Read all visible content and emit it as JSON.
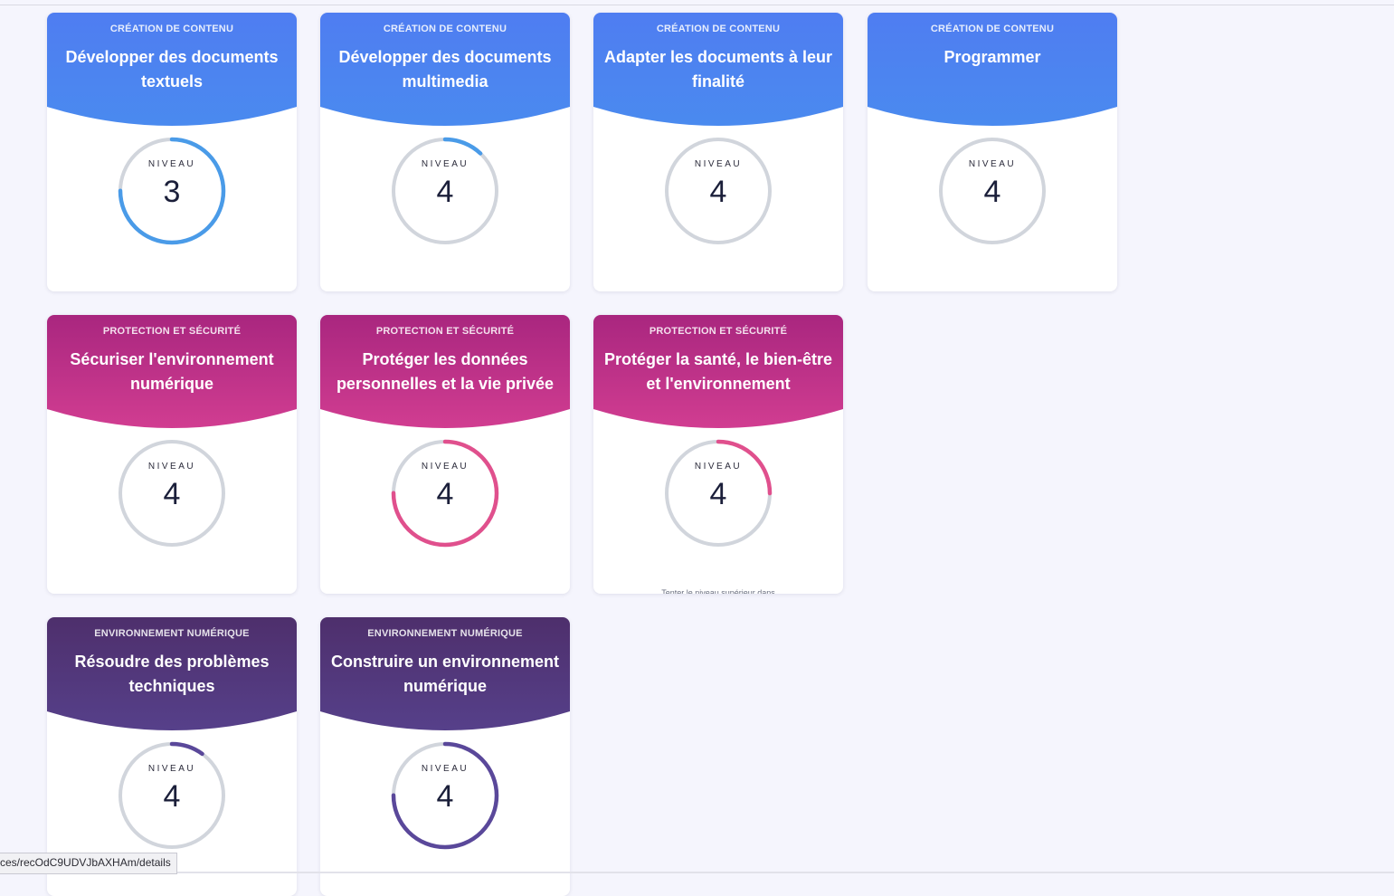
{
  "colors": {
    "creation": [
      "#4f7df1",
      "#4a8aef"
    ],
    "protection": [
      "#a9267f",
      "#d13d91"
    ],
    "environnement": [
      "#4e2f6c",
      "#56408a"
    ],
    "gauge_track": "#d1d5dc",
    "gauge_blue": "#4a9be8",
    "gauge_pink": "#e0508d",
    "gauge_purple": "#5a489a"
  },
  "level_label": "NIVEAU",
  "cards": [
    {
      "domain": "Création de contenu",
      "title": "Développer des documents textuels",
      "level": "3",
      "progress": 0.75,
      "color": "gauge_blue",
      "theme": "creation"
    },
    {
      "domain": "Création de contenu",
      "title": "Développer des documents multimedia",
      "level": "4",
      "progress": 0.12,
      "color": "gauge_blue",
      "theme": "creation"
    },
    {
      "domain": "Création de contenu",
      "title": "Adapter les documents à leur finalité",
      "level": "4",
      "progress": 0,
      "color": "gauge_blue",
      "theme": "creation"
    },
    {
      "domain": "Création de contenu",
      "title": "Programmer",
      "level": "4",
      "progress": 0,
      "color": "gauge_blue",
      "theme": "creation"
    },
    {
      "domain": "Protection et sécurité",
      "title": "Sécuriser l'environnement numérique",
      "level": "4",
      "progress": 0,
      "color": "gauge_pink",
      "theme": "protection"
    },
    {
      "domain": "Protection et sécurité",
      "title": "Protéger les données personnelles et la vie privée",
      "level": "4",
      "progress": 0.75,
      "color": "gauge_pink",
      "theme": "protection"
    },
    {
      "domain": "Protection et sécurité",
      "title": "Protéger la santé, le bien-être et l'environnement",
      "level": "4",
      "progress": 0.25,
      "color": "gauge_pink",
      "theme": "protection",
      "hint": "Tenter le niveau supérieur dans"
    },
    {
      "domain": "Environnement numérique",
      "title": "Résoudre des problèmes techniques",
      "level": "4",
      "progress": 0.1,
      "color": "gauge_purple",
      "theme": "environnement"
    },
    {
      "domain": "Environnement numérique",
      "title": "Construire un environnement numérique",
      "level": "4",
      "progress": 0.75,
      "color": "gauge_purple",
      "theme": "environnement"
    }
  ],
  "status_url": "ces/recOdC9UDVJbAXHAm/details"
}
